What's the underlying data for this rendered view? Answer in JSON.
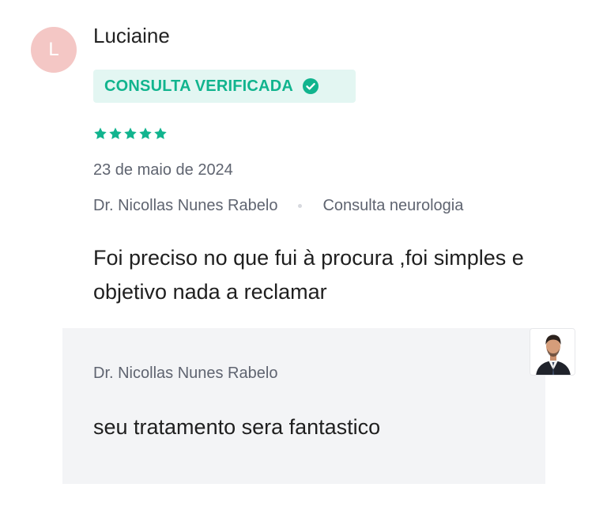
{
  "reviewer": {
    "initial": "L",
    "name": "Luciaine",
    "avatar_color": "#f4c7c5"
  },
  "badge": {
    "label": "CONSULTA VERIFICADA",
    "icon": "check-circle-icon",
    "color": "#11b48e",
    "background": "#e3f6f2"
  },
  "rating": {
    "stars": 5,
    "max": 5,
    "color": "#11b48e"
  },
  "date": "23 de maio de 2024",
  "meta": {
    "doctor": "Dr. Nicollas Nunes Rabelo",
    "service": "Consulta neurologia"
  },
  "comment": "Foi preciso no que fui à procura ,foi simples e objetivo nada a reclamar",
  "reply": {
    "doctor": "Dr. Nicollas Nunes Rabelo",
    "text": "seu tratamento sera fantastico",
    "photo_icon": "doctor-photo"
  }
}
